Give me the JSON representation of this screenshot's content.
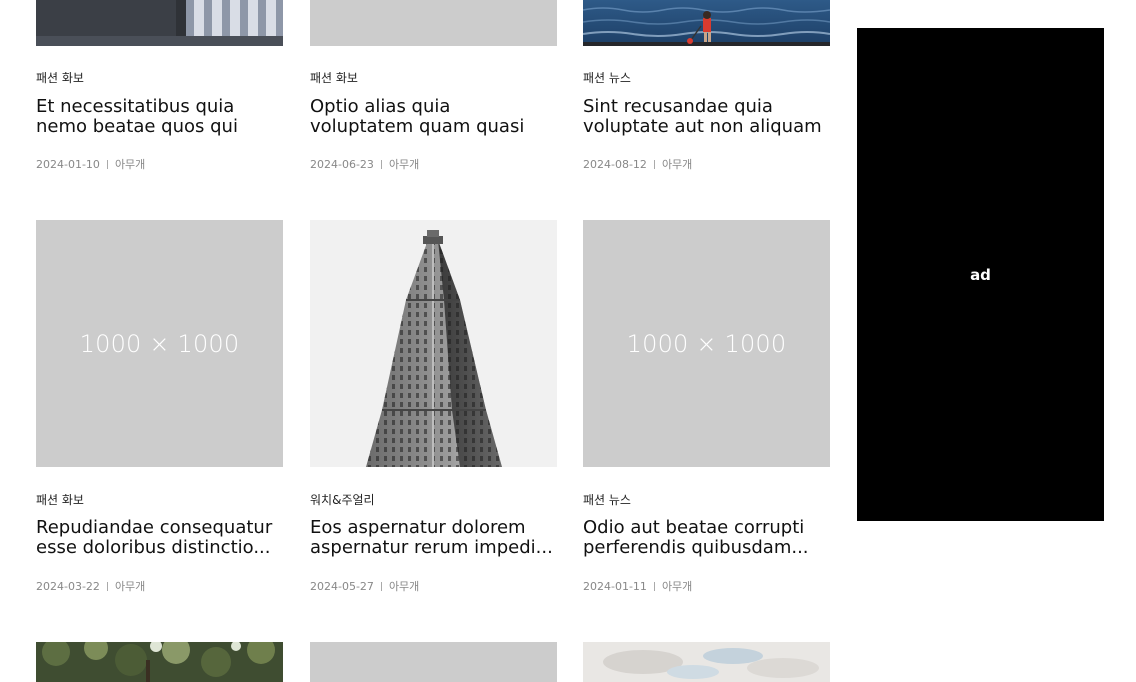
{
  "placeholder_text": "1000 × 1000",
  "ad": {
    "label": "ad"
  },
  "cards": [
    {
      "category": "패션 화보",
      "title": "Et necessitatibus quia nemo beatae quos qui",
      "date": "2024-01-10",
      "author": "아무개",
      "image": "photo-window-blinds"
    },
    {
      "category": "패션 화보",
      "title": "Optio alias quia voluptatem quam quasi",
      "date": "2024-06-23",
      "author": "아무개",
      "image": "placeholder"
    },
    {
      "category": "패션 뉴스",
      "title": "Sint recusandae quia voluptate aut non aliquam",
      "date": "2024-08-12",
      "author": "아무개",
      "image": "photo-sea-child"
    },
    {
      "category": "패션 화보",
      "title": "Repudiandae consequatur esse doloribus distinctio...",
      "date": "2024-03-22",
      "author": "아무개",
      "image": "placeholder"
    },
    {
      "category": "워치&주얼리",
      "title": "Eos aspernatur dolorem aspernatur rerum impedi...",
      "date": "2024-05-27",
      "author": "아무개",
      "image": "photo-flatiron-building"
    },
    {
      "category": "패션 뉴스",
      "title": "Odio aut beatae corrupti perferendis quibusdam...",
      "date": "2024-01-11",
      "author": "아무개",
      "image": "placeholder"
    },
    {
      "image": "photo-trees"
    },
    {
      "image": "placeholder"
    },
    {
      "image": "photo-cloudy-sky"
    }
  ]
}
